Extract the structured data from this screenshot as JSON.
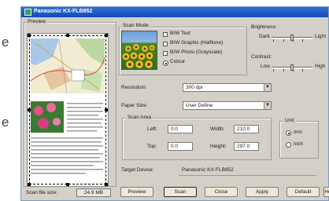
{
  "background": {
    "fragments": [
      "e",
      "e"
    ]
  },
  "window": {
    "title": "Panasonic KX-FLB852"
  },
  "preview": {
    "label": "Preview"
  },
  "scan_mode": {
    "label": "Scan Mode",
    "options": [
      {
        "label": "B/W Text",
        "checked": false
      },
      {
        "label": "B/W Graphic (Halftone)",
        "checked": false
      },
      {
        "label": "B/W Photo (Grayscale)",
        "checked": false
      },
      {
        "label": "Colour",
        "checked": true
      }
    ]
  },
  "brightness": {
    "label": "Brightness:",
    "low": "Dark",
    "high": "Light",
    "level": 0.5
  },
  "contrast": {
    "label": "Contrast:",
    "low": "Low",
    "high": "High",
    "level": 0.5
  },
  "resolution": {
    "label": "Resolution:",
    "value": "300 dpi"
  },
  "paper_size": {
    "label": "Paper Size:",
    "value": "User Define"
  },
  "scan_area": {
    "label": "Scan Area",
    "left_label": "Left:",
    "left_value": "0.0",
    "top_label": "Top:",
    "top_value": "0.0",
    "width_label": "Width:",
    "width_value": "210.0",
    "height_label": "Height:",
    "height_value": "297.0"
  },
  "unit": {
    "label": "Unit",
    "options": [
      {
        "label": "mm",
        "selected": true
      },
      {
        "label": "inch",
        "selected": false
      }
    ]
  },
  "target_device": {
    "label": "Target Device:",
    "value": "Panasonic KX-FLB852"
  },
  "scan_file_size": {
    "label": "Scan file size:",
    "value": "24.9 MB"
  },
  "buttons": {
    "preview": "Preview",
    "scan": "Scan",
    "close": "Close",
    "apply": "Apply",
    "default": "Default",
    "help": "He"
  },
  "colors": {
    "title_bar": "#1f5bc9",
    "dialog_bg": "#d4d0c8"
  }
}
